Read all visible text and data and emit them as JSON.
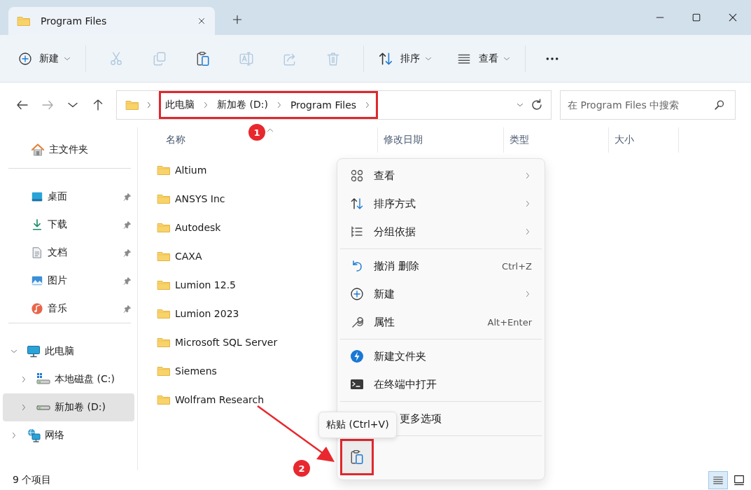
{
  "window": {
    "tab_title": "Program Files"
  },
  "toolbar": {
    "new": {
      "label": "新建"
    },
    "actions": [
      {
        "kind": "cut",
        "disabled": true
      },
      {
        "kind": "copy",
        "disabled": true
      },
      {
        "kind": "paste",
        "disabled": false
      },
      {
        "kind": "rename",
        "disabled": true
      },
      {
        "kind": "share",
        "disabled": true
      },
      {
        "kind": "delete",
        "disabled": true
      }
    ],
    "sort": {
      "label": "排序"
    },
    "view": {
      "label": "查看"
    }
  },
  "navigation": [
    {
      "kind": "back",
      "disabled": false
    },
    {
      "kind": "forward",
      "disabled": true
    },
    {
      "kind": "recent",
      "disabled": false
    },
    {
      "kind": "up",
      "disabled": false
    }
  ],
  "address": {
    "crumbs": [
      "此电脑",
      "新加卷 (D:)",
      "Program Files"
    ],
    "search_placeholder": "在 Program Files 中搜索"
  },
  "sidebar": {
    "home": "主文件夹",
    "quick_access": [
      {
        "label": "桌面",
        "kind": "desktop",
        "pinned": true
      },
      {
        "label": "下载",
        "kind": "download",
        "pinned": true
      },
      {
        "label": "文档",
        "kind": "document",
        "pinned": true
      },
      {
        "label": "图片",
        "kind": "pictures",
        "pinned": true
      },
      {
        "label": "音乐",
        "kind": "music",
        "pinned": true
      }
    ],
    "tree": [
      {
        "label": "此电脑",
        "kind": "pc",
        "expanded": true,
        "selected": false,
        "children": [
          {
            "label": "本地磁盘 (C:)",
            "kind": "system-drive",
            "expanded": false,
            "selected": false
          },
          {
            "label": "新加卷 (D:)",
            "kind": "drive",
            "expanded": false,
            "selected": true
          }
        ]
      },
      {
        "label": "网络",
        "kind": "network",
        "expanded": false,
        "selected": false
      }
    ]
  },
  "columns": [
    {
      "label": "名称",
      "sorted": true
    },
    {
      "label": "修改日期",
      "sorted": false
    },
    {
      "label": "类型",
      "sorted": false
    },
    {
      "label": "大小",
      "sorted": false
    }
  ],
  "files": [
    "Altium",
    "ANSYS Inc",
    "Autodesk",
    "CAXA",
    "Lumion 12.5",
    "Lumion 2023",
    "Microsoft SQL Server",
    "Siemens",
    "Wolfram Research"
  ],
  "context_menu": {
    "sections": [
      [
        {
          "kind": "view",
          "label": "查看",
          "submenu": true
        },
        {
          "kind": "sort",
          "label": "排序方式",
          "submenu": true
        },
        {
          "kind": "group",
          "label": "分组依据",
          "submenu": true
        }
      ],
      [
        {
          "kind": "undo",
          "label": "撤消 删除",
          "shortcut": "Ctrl+Z",
          "submenu": false
        },
        {
          "kind": "new",
          "label": "新建",
          "submenu": true
        },
        {
          "kind": "properties",
          "label": "属性",
          "shortcut": "Alt+Enter",
          "submenu": false
        }
      ],
      [
        {
          "kind": "newfolder",
          "label": "新建文件夹",
          "submenu": false
        },
        {
          "kind": "terminal",
          "label": "在终端中打开",
          "submenu": false
        }
      ],
      [
        {
          "kind": "more",
          "label": "更多选项",
          "submenu": false
        }
      ]
    ],
    "bottom_actions": [
      {
        "kind": "paste",
        "highlighted": true
      }
    ],
    "tooltip": "粘贴 (Ctrl+V)"
  },
  "status_bar": {
    "count": "9 个项目",
    "view_modes": [
      {
        "kind": "details",
        "selected": true
      },
      {
        "kind": "tiles",
        "selected": false
      }
    ]
  },
  "annotations": [
    {
      "label": "1"
    },
    {
      "label": "2"
    }
  ]
}
